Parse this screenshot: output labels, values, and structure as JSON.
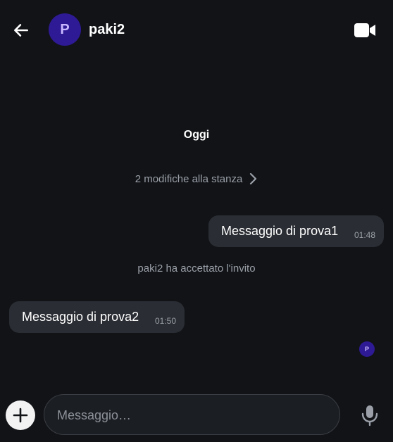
{
  "header": {
    "back_icon": "arrow-left-icon",
    "avatar_initial": "P",
    "title": "paki2",
    "video_icon": "video-camera-icon"
  },
  "timeline": {
    "date_separator": "Oggi",
    "room_changes": "2 modifiche alla stanza",
    "room_changes_icon": "chevron-right-icon",
    "messages": [
      {
        "direction": "outgoing",
        "text": "Messaggio di prova1",
        "time": "01:48"
      },
      {
        "direction": "incoming",
        "text": "Messaggio di prova2",
        "time": "01:50"
      }
    ],
    "system_event": "paki2 ha accettato l'invito",
    "read_receipt_initial": "P"
  },
  "composer": {
    "add_icon": "plus-icon",
    "placeholder": "Messaggio…",
    "value": "",
    "mic_icon": "microphone-icon"
  },
  "colors": {
    "background": "#111317",
    "bubble": "#2a2d33",
    "avatar_bg": "#2e1a94",
    "avatar_text": "#c9b8ff",
    "muted_text": "#9ba0a8"
  }
}
